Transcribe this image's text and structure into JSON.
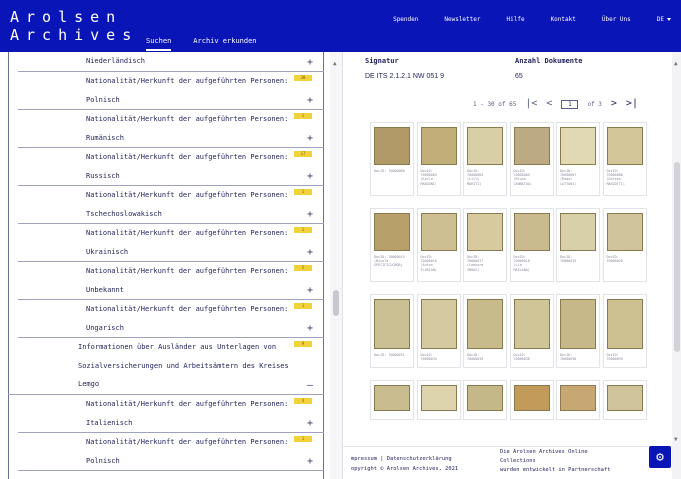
{
  "header": {
    "logo_line1": "Arolsen",
    "logo_line2": "Archives",
    "main_nav": [
      {
        "label": "Suchen",
        "active": true
      },
      {
        "label": "Archiv erkunden",
        "active": false
      }
    ],
    "top_nav": [
      "Spenden",
      "Newsletter",
      "Hilfe",
      "Kontakt",
      "Über Uns"
    ],
    "language": "DE"
  },
  "tree": {
    "prefix": "Nationalität/Herkunft der aufgeführten Personen:",
    "rows": [
      {
        "kind": "item",
        "lines": [
          "Niederländisch"
        ],
        "badge": "",
        "toggle": "+"
      },
      {
        "kind": "item",
        "lines": [
          "Nationalität/Herkunft der aufgeführten Personen:",
          "Polnisch"
        ],
        "badge": "38",
        "toggle": "+"
      },
      {
        "kind": "item",
        "lines": [
          "Nationalität/Herkunft der aufgeführten Personen:",
          "Rumänisch"
        ],
        "badge": "1",
        "toggle": "+"
      },
      {
        "kind": "item",
        "lines": [
          "Nationalität/Herkunft der aufgeführten Personen:",
          "Russisch"
        ],
        "badge": "17",
        "toggle": "+"
      },
      {
        "kind": "item",
        "lines": [
          "Nationalität/Herkunft der aufgeführten Personen:",
          "Tschechoslowakisch"
        ],
        "badge": "1",
        "toggle": "+"
      },
      {
        "kind": "item",
        "lines": [
          "Nationalität/Herkunft der aufgeführten Personen:",
          "Ukrainisch"
        ],
        "badge": "1",
        "toggle": "+"
      },
      {
        "kind": "item",
        "lines": [
          "Nationalität/Herkunft der aufgeführten Personen:",
          "Unbekannt"
        ],
        "badge": "5",
        "toggle": "+"
      },
      {
        "kind": "item",
        "lines": [
          "Nationalität/Herkunft der aufgeführten Personen:",
          "Ungarisch"
        ],
        "badge": "1",
        "toggle": "+"
      },
      {
        "kind": "section",
        "lines": [
          "Informationen über Ausländer aus Unterlagen von",
          "Sozialversicherungen und Arbeitsämtern des Kreises",
          "Lemgo"
        ],
        "badge": "9",
        "toggle": "–"
      },
      {
        "kind": "item",
        "lines": [
          "Nationalität/Herkunft der aufgeführten Personen:",
          "Italienisch"
        ],
        "badge": "4",
        "toggle": "+"
      },
      {
        "kind": "item",
        "lines": [
          "Nationalität/Herkunft der aufgeführten Personen:",
          "Polnisch"
        ],
        "badge": "1",
        "toggle": "+"
      }
    ]
  },
  "details": {
    "signatur_label": "Signatur",
    "signatur_value": "DE ITS 2.1.2.1 NW 051 9",
    "anzahl_label": "Anzahl Dokumente",
    "anzahl_value": "65"
  },
  "pager": {
    "range": "1 - 30 of 65",
    "first": "|<",
    "prev": "<",
    "page": "1",
    "of_total": "of 3",
    "next": ">",
    "last": ">|"
  },
  "thumbnails": [
    {
      "caption": "DocID: 70000000",
      "tone": "#b29a68"
    },
    {
      "caption": "DocID:\n70000003\n(Karla\nMANZONI)",
      "tone": "#c2ae78"
    },
    {
      "caption": "DocID:\n70000004\n(Lilly\nMARITI)",
      "tone": "#d9cfa6"
    },
    {
      "caption": "DocID:\n70000005\n(Bruno\nCANNATOA)",
      "tone": "#bcaa82"
    },
    {
      "caption": "DocID:\n70000007\n(Roger\nCATTONI)",
      "tone": "#e1d9b4"
    },
    {
      "caption": "DocID:\n70000008\n(Doreen\nMARZOTTI)",
      "tone": "#d3c79a"
    },
    {
      "caption": "DocID: 70000015\n(Nicola\nSPECIFICUCNOR)",
      "tone": "#b8a06a"
    },
    {
      "caption": "DocID:\n70000016\n(Anton\nFLORIAN)",
      "tone": "#cdbf92"
    },
    {
      "caption": "DocID:\n70000017\n(Leonard\nIMHAS)",
      "tone": "#d6ca9e"
    },
    {
      "caption": "DocID:\n70000018\n(Lia\nMAZLANA)",
      "tone": "#c9bb8e"
    },
    {
      "caption": "DocID:\n70000019",
      "tone": "#d8d0a8"
    },
    {
      "caption": "DocID:\n70000020",
      "tone": "#cfc49a"
    },
    {
      "caption": "DocID: 70000031",
      "tone": "#cbbf94"
    },
    {
      "caption": "DocID:\n70000034",
      "tone": "#d5c99f"
    },
    {
      "caption": "DocID:\n70000035",
      "tone": "#c8bb8b"
    },
    {
      "caption": "DocID:\n70000036",
      "tone": "#d0c597"
    },
    {
      "caption": "DocID:\n70000038",
      "tone": "#c6b889"
    },
    {
      "caption": "DocID:\n70000039",
      "tone": "#cdc192"
    },
    {
      "caption": "",
      "tone": "#c9bd90"
    },
    {
      "caption": "",
      "tone": "#ddd4ae"
    },
    {
      "caption": "",
      "tone": "#c4b889"
    },
    {
      "caption": "",
      "tone": "#c29a5a"
    },
    {
      "caption": "",
      "tone": "#c8a872"
    },
    {
      "caption": "",
      "tone": "#cfc49a"
    }
  ],
  "footer": {
    "links": "mpressum  |  Datenschutzerklärung",
    "copyright": "opyright © Arolsen Archives, 2021",
    "right_line1": "Die Arolsen Archives Online",
    "right_line2": "Collections",
    "right_line3": "wurden entwickelt in Partnerschaft"
  },
  "colors": {
    "brand_blue": "#0a15b8",
    "badge_yellow": "#f2d23a",
    "text_navy": "#23235e"
  },
  "icons": {
    "settings": "gear-icon",
    "language_caret": "chevron-down-icon"
  }
}
